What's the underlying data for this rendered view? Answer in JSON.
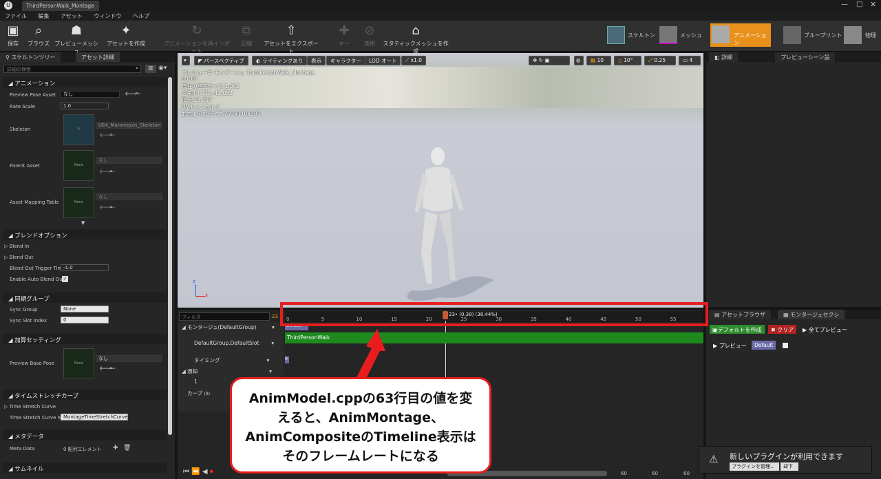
{
  "window": {
    "title": "ThirdPersonWalk_Montage"
  },
  "menu": [
    "ファイル",
    "編集",
    "アセット",
    "ウィンドウ",
    "ヘルプ"
  ],
  "toolbar": {
    "save": "保存",
    "browse": "ブラウズ",
    "preview_mesh": "プレビューメッシュ",
    "create_asset": "アセットを作成",
    "reimport": "アニメーションを再インポート",
    "compress": "圧縮",
    "export": "アセットをエクスポート",
    "key": "キー",
    "apply": "適用",
    "static_mesh": "スタティックメッシュを作成"
  },
  "modes": {
    "skeleton": "スケルトン",
    "mesh": "メッシュ",
    "animation": "アニメーション",
    "blueprint": "ブループリント",
    "physics": "物理"
  },
  "left": {
    "tabs": [
      "スケルトンツリー",
      "アセット詳細"
    ],
    "search_placeholder": "詳細の検索",
    "sections": {
      "animation": "アニメーション",
      "blend": "ブレンドオプション",
      "sync": "同期グループ",
      "additive": "加算セッティング",
      "timestretch": "タイムストレッチカーブ",
      "metadata": "メタデータ",
      "thumbnail": "サムネイル"
    },
    "preview_pose_asset": {
      "label": "Preview Pose Asset",
      "value": "なし"
    },
    "rate_scale": {
      "label": "Rate Scale",
      "value": "1.0"
    },
    "skeleton": {
      "label": "Skeleton",
      "value": "UE4_Mannequin_Skeleton"
    },
    "parent_asset": {
      "label": "Parent Asset",
      "value": "なし",
      "thumb": "None"
    },
    "asset_mapping": {
      "label": "Asset Mapping Table",
      "value": "なし",
      "thumb": "None"
    },
    "blend_in": "Blend In",
    "blend_out": "Blend Out",
    "blend_out_trigger": {
      "label": "Blend Out Trigger Tim",
      "value": "-1.0"
    },
    "enable_auto_blend": "Enable Auto Blend Ou",
    "sync_group": {
      "label": "Sync Group",
      "value": "None"
    },
    "sync_slot": {
      "label": "Sync Slot Index",
      "value": "0"
    },
    "preview_base_pose": {
      "label": "Preview Base Pose",
      "value": "なし",
      "thumb": "None"
    },
    "time_stretch_curve": "Time Stretch Curve",
    "time_stretch_curve_n": {
      "label": "Time Stretch Curve N",
      "value": "MontageTimeStretchCurve"
    },
    "meta_data": {
      "label": "Meta Data",
      "value": "0 配列エレメント"
    }
  },
  "viewport": {
    "perspective": "パースペクティブ",
    "lighting": "ライティングあり",
    "show": "表示",
    "character": "キャラクター",
    "lod": "LOD オート",
    "speed": "x1.0",
    "grid_val": "10",
    "angle_val": "10°",
    "scale_val": "0.25",
    "cam_val": "4",
    "info": [
      "プレビュー中 モンタージュ ThirdPersonWalk_Montage",
      "LOD:0",
      "現在の画面サイズ:1.002",
      "三角ポリゴン:41,052",
      "頂点:23,297",
      "UVチャンネル:1",
      "おおよそのサイズ:277x110x283"
    ]
  },
  "timeline": {
    "filter": "フィルタ",
    "frame_readout": "23",
    "playhead": "23• (0.38) (38.44%)",
    "ticks": [
      "0",
      "5",
      "10",
      "15",
      "20",
      "25",
      "30",
      "35",
      "40",
      "45",
      "50",
      "55"
    ],
    "tracks": {
      "montage": "モンタージュ(DefaultGroup)",
      "slot": "DefaultGroup.DefaultSlot",
      "timing": "タイミング",
      "notify": "通知",
      "notify_1": "1",
      "curve": "カーブ",
      "curve_count": "(0)"
    },
    "segment": "ThirdPersonWalk",
    "section": "Default",
    "bottom_a": "60",
    "bottom_b": "60",
    "bottom_c": "60"
  },
  "right": {
    "tabs": [
      "詳細",
      "プレビューシーン設"
    ],
    "bottom_tabs": [
      "アセットブラウザ",
      "モンタージュセクシ"
    ],
    "create_default": "デフォルトを作成",
    "clear": "クリア",
    "preview_all": "全てプレビュー",
    "preview": "プレビュー",
    "default": "Default"
  },
  "notification": {
    "text": "新しいプラグインが利用できます",
    "manage": "プラグインを管理...",
    "dismiss": "却下"
  },
  "callout": {
    "text": "AnimModel.cppの63行目の値を変えると、AnimMontage、AnimCompositeのTimeline表示はそのフレームレートになる"
  },
  "colors": {
    "highlight": "#e81e1e",
    "accent": "#f39c12",
    "track": "#1e8a1e"
  }
}
